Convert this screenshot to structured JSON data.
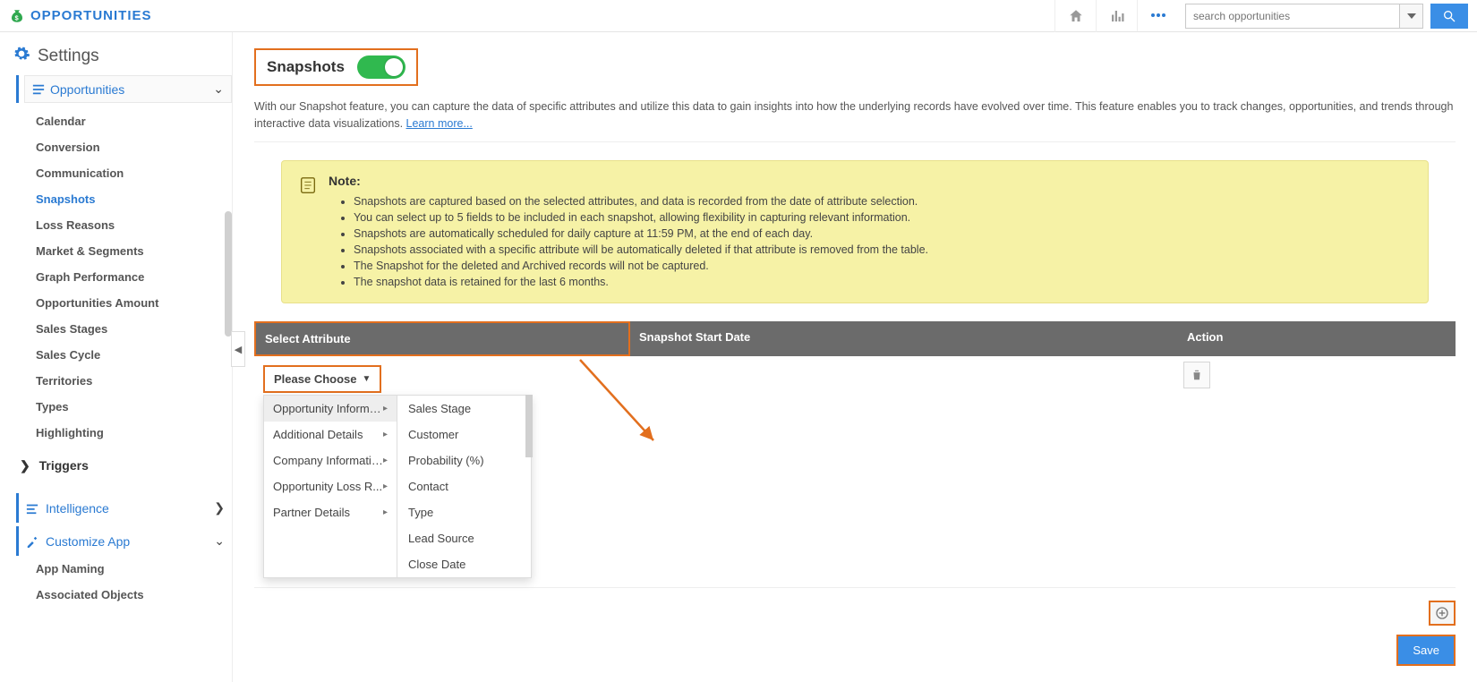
{
  "brand": "OPPORTUNITIES",
  "search": {
    "placeholder": "search opportunities"
  },
  "sidebar": {
    "title": "Settings",
    "group1": {
      "label": "Opportunities"
    },
    "items": [
      "Calendar",
      "Conversion",
      "Communication",
      "Snapshots",
      "Loss Reasons",
      "Market & Segments",
      "Graph Performance",
      "Opportunities Amount",
      "Sales Stages",
      "Sales Cycle",
      "Territories",
      "Types",
      "Highlighting"
    ],
    "selected": "Snapshots",
    "triggers": "Triggers",
    "intelligence": "Intelligence",
    "customize": "Customize App",
    "sub2": [
      "App Naming",
      "Associated Objects"
    ]
  },
  "page": {
    "title": "Snapshots",
    "desc": "With our Snapshot feature, you can capture the data of specific attributes and utilize this data to gain insights into how the underlying records have evolved over time. This feature enables you to track changes, opportunities, and trends through interactive data visualizations. ",
    "learn": "Learn more..."
  },
  "note": {
    "title": "Note:",
    "items": [
      "Snapshots are captured based on the selected attributes, and data is recorded from the date of attribute selection.",
      "You can select up to 5 fields to be included in each snapshot, allowing flexibility in capturing relevant information.",
      "Snapshots are automatically scheduled for daily capture at 11:59 PM, at the end of each day.",
      "Snapshots associated with a specific attribute will be automatically deleted if that attribute is removed from the table.",
      "The Snapshot for the deleted and Archived records will not be captured.",
      "The snapshot data is retained for the last 6 months."
    ]
  },
  "table": {
    "h1": "Select Attribute",
    "h2": "Snapshot Start Date",
    "h3": "Action",
    "choose": "Please Choose"
  },
  "dropdown": {
    "groups": [
      "Opportunity Informa...",
      "Additional Details",
      "Company Information",
      "Opportunity Loss R...",
      "Partner Details"
    ],
    "fields": [
      "Sales Stage",
      "Customer",
      "Probability (%)",
      "Contact",
      "Type",
      "Lead Source",
      "Close Date"
    ]
  },
  "buttons": {
    "save": "Save"
  }
}
